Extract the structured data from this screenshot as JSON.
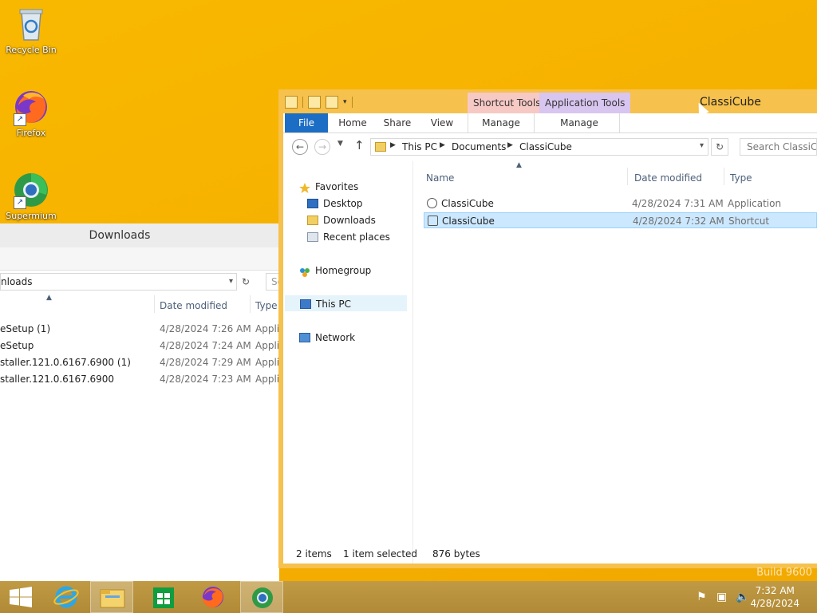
{
  "desktop": {
    "icons": [
      {
        "label": "Recycle Bin"
      },
      {
        "label": "Firefox"
      },
      {
        "label": "Supermium"
      }
    ],
    "build_text": "Build 9600"
  },
  "back_window": {
    "title": "Downloads",
    "address_fragment": "nloads",
    "search_fragment": "Se",
    "columns": {
      "date": "Date modified",
      "type": "Type"
    },
    "rows": [
      {
        "name": "eSetup (1)",
        "date": "4/28/2024 7:26 AM",
        "type": "Appli"
      },
      {
        "name": "eSetup",
        "date": "4/28/2024 7:24 AM",
        "type": "Appli"
      },
      {
        "name": "staller.121.0.6167.6900 (1)",
        "date": "4/28/2024 7:29 AM",
        "type": "Appli"
      },
      {
        "name": "staller.121.0.6167.6900",
        "date": "4/28/2024 7:23 AM",
        "type": "Appli"
      }
    ]
  },
  "window": {
    "title": "ClassiCube",
    "context_tabs": {
      "shortcut": "Shortcut Tools",
      "application": "Application Tools"
    },
    "tabs": {
      "file": "File",
      "home": "Home",
      "share": "Share",
      "view": "View",
      "manage1": "Manage",
      "manage2": "Manage"
    },
    "breadcrumb": [
      "This PC",
      "Documents",
      "ClassiCube"
    ],
    "search_placeholder": "Search ClassiCube",
    "nav": {
      "favorites": "Favorites",
      "desktop": "Desktop",
      "downloads": "Downloads",
      "recent": "Recent places",
      "homegroup": "Homegroup",
      "thispc": "This PC",
      "network": "Network"
    },
    "columns": {
      "name": "Name",
      "date": "Date modified",
      "type": "Type"
    },
    "files": [
      {
        "name": "ClassiCube",
        "date": "4/28/2024 7:31 AM",
        "type": "Application"
      },
      {
        "name": "ClassiCube",
        "date": "4/28/2024 7:32 AM",
        "type": "Shortcut"
      }
    ],
    "status": {
      "items": "2 items",
      "selected": "1 item selected",
      "size": "876 bytes"
    }
  },
  "taskbar": {
    "time": "7:32 AM",
    "date": "4/28/2024"
  }
}
